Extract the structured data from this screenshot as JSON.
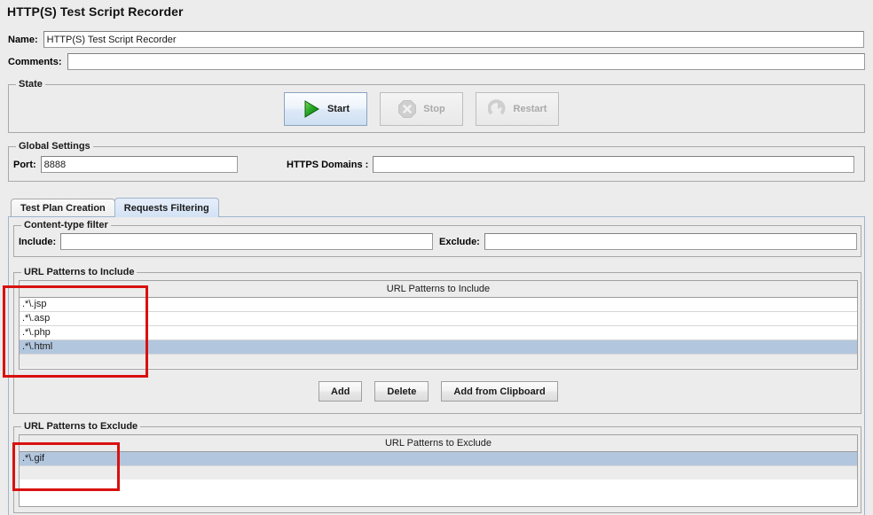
{
  "window": {
    "title": "HTTP(S) Test Script Recorder",
    "background_color": "#ececec"
  },
  "fields": {
    "name_label": "Name:",
    "name_value": "HTTP(S) Test Script Recorder",
    "comments_label": "Comments:",
    "comments_value": ""
  },
  "state_panel": {
    "title": "State",
    "buttons": [
      {
        "label": "Start",
        "icon": "play-icon",
        "enabled": true
      },
      {
        "label": "Stop",
        "icon": "stop-icon",
        "enabled": false
      },
      {
        "label": "Restart",
        "icon": "restart-icon",
        "enabled": false
      }
    ]
  },
  "global_settings": {
    "title": "Global Settings",
    "port_label": "Port:",
    "port_value": "8888",
    "https_domains_label": "HTTPS Domains :",
    "https_domains_value": ""
  },
  "tabs": [
    {
      "label": "Test Plan Creation",
      "selected": false
    },
    {
      "label": "Requests Filtering",
      "selected": true
    }
  ],
  "content_type_filter": {
    "title": "Content-type filter",
    "include_label": "Include:",
    "include_value": "",
    "exclude_label": "Exclude:",
    "exclude_value": ""
  },
  "url_patterns_include": {
    "title": "URL Patterns to Include",
    "column_header": "URL Patterns to Include",
    "rows": [
      {
        "value": ".*\\.jsp",
        "selected": false
      },
      {
        "value": ".*\\.asp",
        "selected": false
      },
      {
        "value": ".*\\.php",
        "selected": false
      },
      {
        "value": ".*\\.html",
        "selected": true
      }
    ],
    "buttons": [
      {
        "label": "Add"
      },
      {
        "label": "Delete"
      },
      {
        "label": "Add from Clipboard"
      }
    ]
  },
  "url_patterns_exclude": {
    "title": "URL Patterns to Exclude",
    "column_header": "URL Patterns to Exclude",
    "rows": [
      {
        "value": ".*\\.gif",
        "selected": true
      }
    ]
  },
  "annotations": {
    "highlight_color": "#d8110f",
    "boxes": [
      {
        "name": "include-patterns-highlight"
      },
      {
        "name": "exclude-patterns-highlight"
      }
    ]
  }
}
